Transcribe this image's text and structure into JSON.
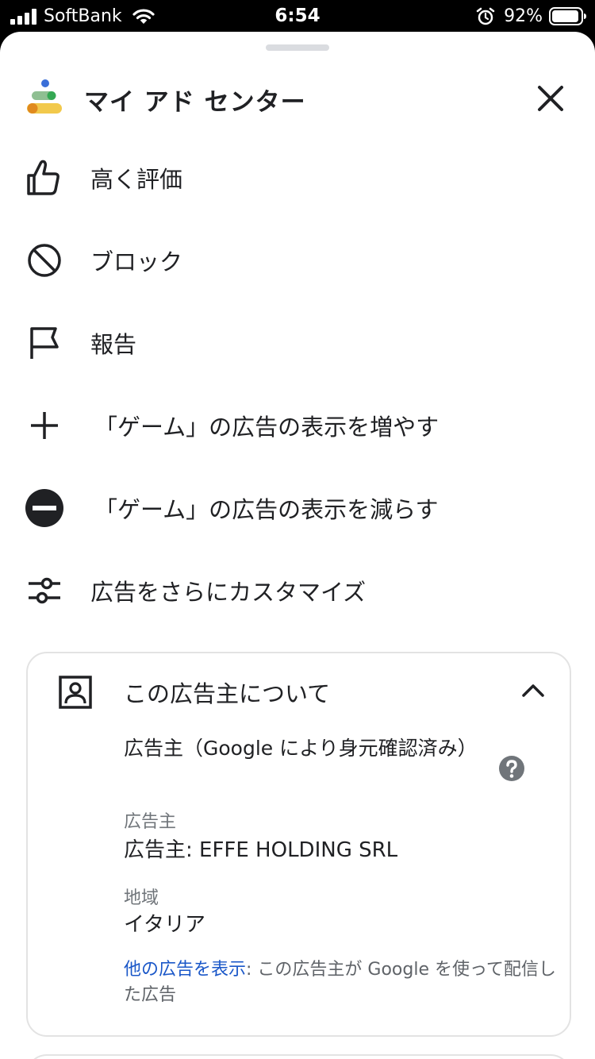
{
  "status_bar": {
    "carrier": "SoftBank",
    "time": "6:54",
    "battery": "92%"
  },
  "header": {
    "title": "マイ アド センター"
  },
  "menu": [
    {
      "label": "高く評価",
      "icon": "thumb-up-icon"
    },
    {
      "label": "ブロック",
      "icon": "block-icon"
    },
    {
      "label": "報告",
      "icon": "flag-icon"
    },
    {
      "label": "「ゲーム」の広告の表示を増やす",
      "icon": "plus-icon"
    },
    {
      "label": "「ゲーム」の広告の表示を減らす",
      "icon": "minus-circle-icon"
    },
    {
      "label": "広告をさらにカスタマイズ",
      "icon": "tune-icon"
    }
  ],
  "advertiser_card": {
    "title": "この広告主について",
    "heading": "広告主（Google により身元確認済み）",
    "advertiser_label": "広告主",
    "advertiser_value": "広告主: EFFE HOLDING SRL",
    "region_label": "地域",
    "region_value": "イタリア",
    "more_ads_link": "他の広告を表示",
    "more_ads_text": ": この広告主が Google を使って配信した広告"
  },
  "colors": {
    "link": "#1a57c8",
    "logo_blue": "#3a6fd8",
    "logo_green": "#34a853",
    "logo_yellow": "#f2c94c",
    "logo_orange": "#e08a1e"
  }
}
